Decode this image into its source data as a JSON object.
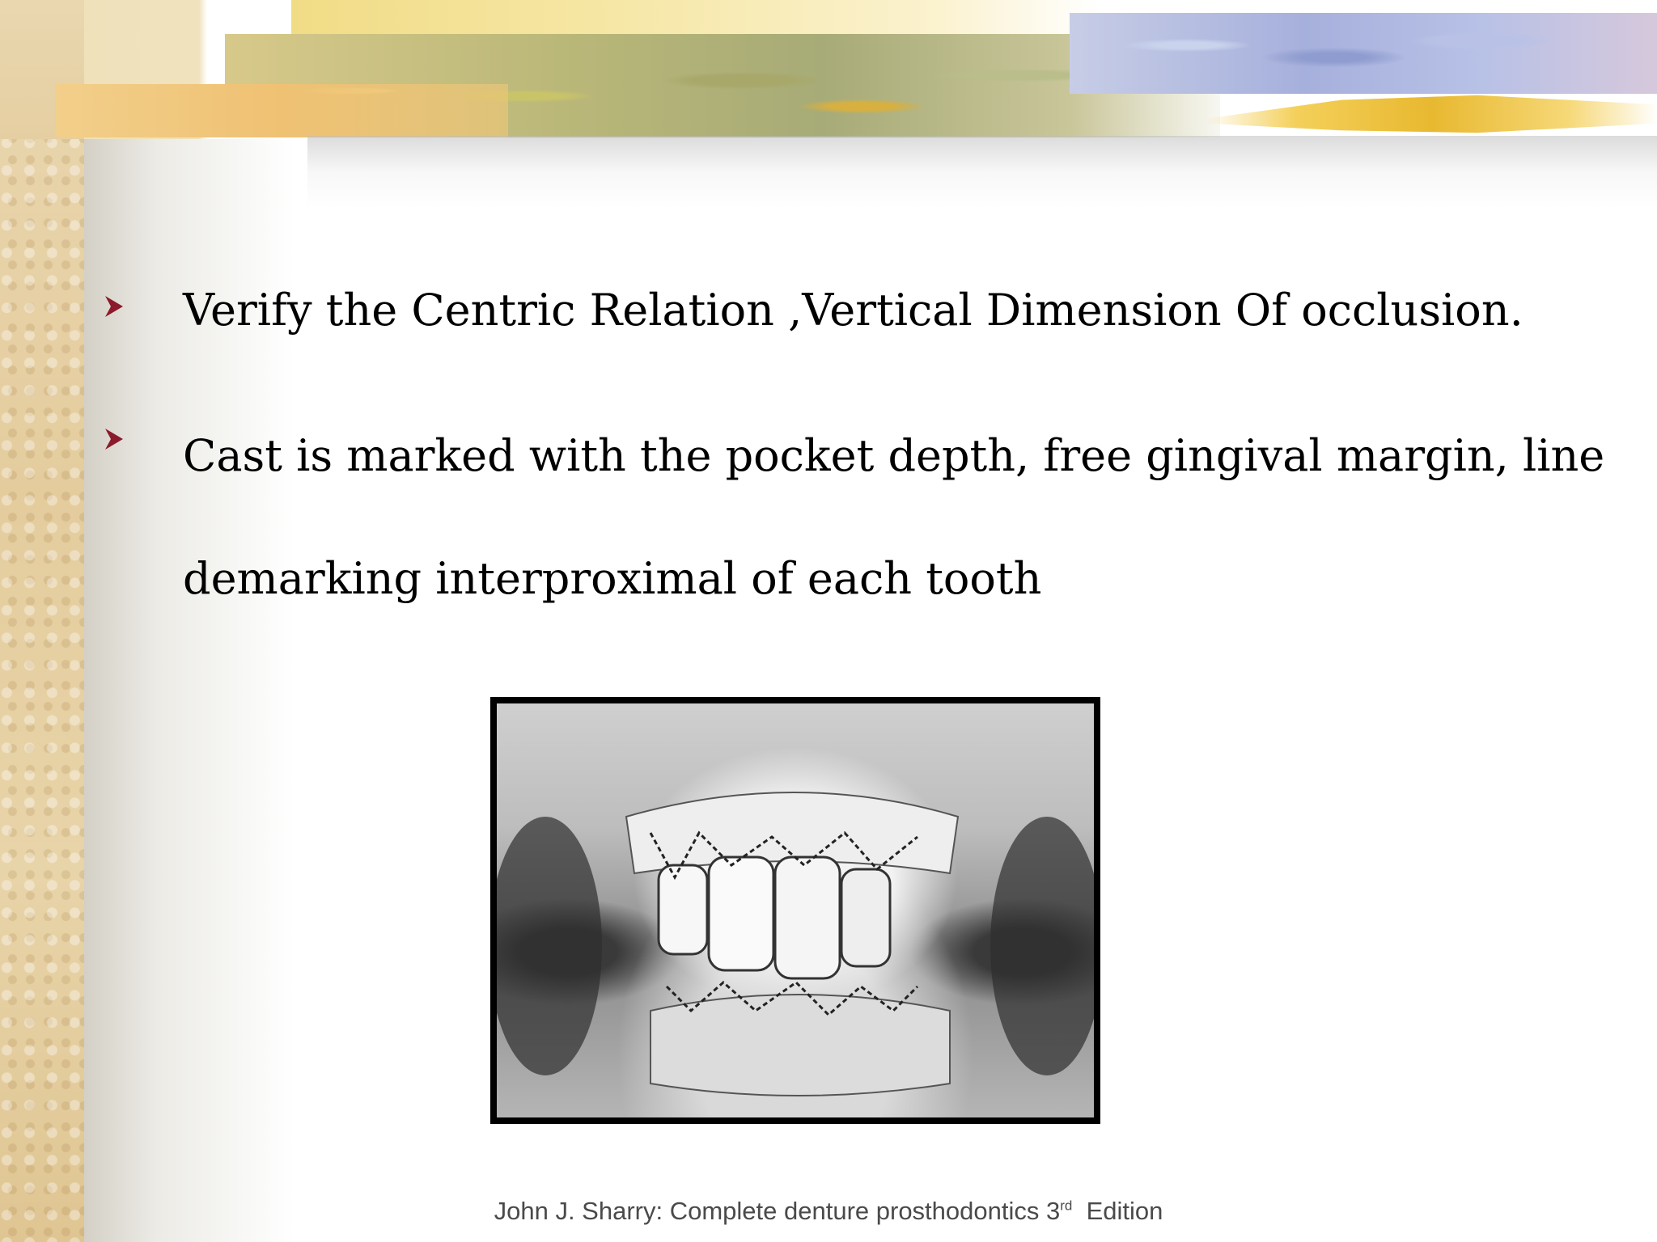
{
  "bullets": [
    {
      "text": "Verify the Centric Relation ,Vertical Dimension Of occlusion."
    },
    {
      "text": "Cast is marked with the pocket depth, free gingival margin, line demarking interproximal of each tooth"
    }
  ],
  "bullet_icon": "arrowhead-bullet-icon",
  "accent_color": "#8b1a2b",
  "citation": {
    "main": "John J. Sharry: Complete denture prosthodontics 3",
    "superscript": "rd",
    "suffix": "  Edition"
  },
  "figure": {
    "icon": "dental-cast-photo"
  }
}
